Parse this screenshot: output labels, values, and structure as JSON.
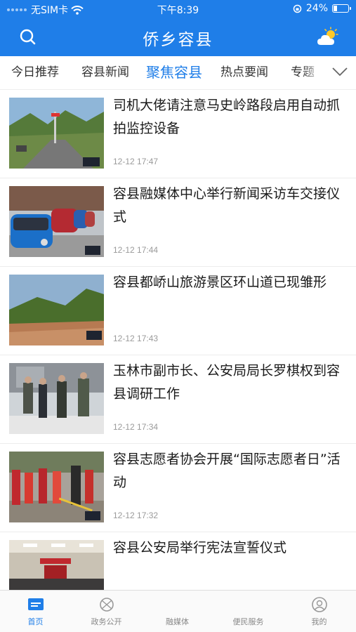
{
  "status_bar": {
    "carrier": "无SIM卡",
    "time": "下午8:39",
    "battery": "24%"
  },
  "header": {
    "title": "侨乡容县",
    "search_icon": "search-icon",
    "weather_icon": "weather-icon"
  },
  "tabs": [
    {
      "label": "今日推荐"
    },
    {
      "label": "容县新闻"
    },
    {
      "label": "聚焦容县",
      "active": true
    },
    {
      "label": "热点要闻"
    },
    {
      "label": "专题"
    }
  ],
  "news": [
    {
      "title": "司机大佬请注意马史岭路段启用自动抓拍监控设备",
      "time": "12-12 17:47",
      "badge": "聚焦容县"
    },
    {
      "title": "容县融媒体中心举行新闻采访车交接仪式",
      "time": "12-12 17:44",
      "badge": "聚焦容县"
    },
    {
      "title": "容县都峤山旅游景区环山道已现雏形",
      "time": "12-12 17:43",
      "badge": "聚焦容县"
    },
    {
      "title": "玉林市副市长、公安局局长罗棋权到容县调研工作",
      "time": "12-12 17:34",
      "badge": ""
    },
    {
      "title": "容县志愿者协会开展“国际志愿者日”活动",
      "time": "12-12 17:32",
      "badge": "聚焦容县"
    },
    {
      "title": "容县公安局举行宪法宣誓仪式",
      "time": "",
      "badge": ""
    }
  ],
  "bottom_nav": [
    {
      "label": "首页",
      "icon": "home-icon",
      "active": true
    },
    {
      "label": "政务公开",
      "icon": "government-icon"
    },
    {
      "label": "融媒体",
      "icon": "media-icon"
    },
    {
      "label": "便民服务",
      "icon": "service-icon"
    },
    {
      "label": "我的",
      "icon": "profile-icon"
    }
  ],
  "colors": {
    "brand": "#1f7ee8",
    "inactive": "#888888",
    "time_text": "#9a9a9a"
  }
}
